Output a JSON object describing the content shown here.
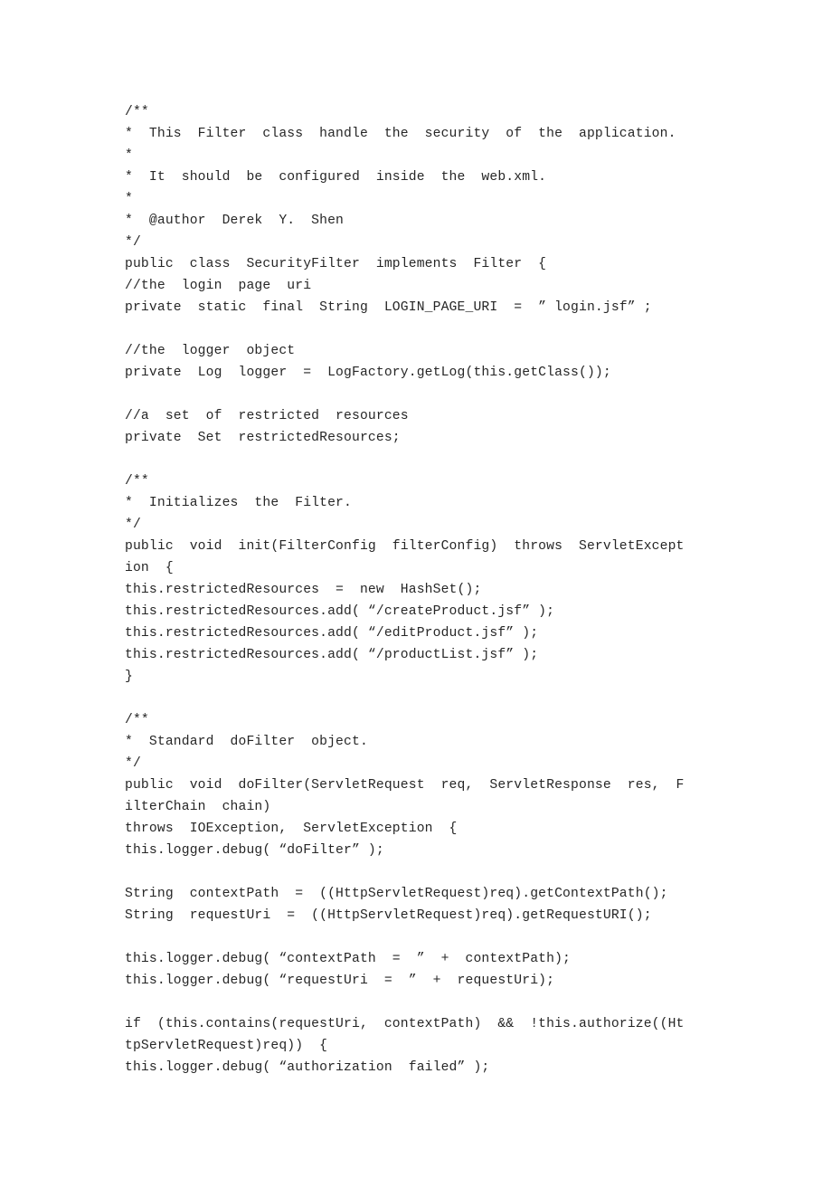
{
  "document": {
    "type": "source-code-listing",
    "language": "java",
    "page_background": "#ffffff",
    "text_color": "#262626",
    "lines": [
      "/**",
      "*  This  Filter  class  handle  the  security  of  the  application.",
      "*",
      "*  It  should  be  configured  inside  the  web.xml.",
      "*",
      "*  @author  Derek  Y.  Shen",
      "*/",
      "public  class  SecurityFilter  implements  Filter  {",
      "//the  login  page  uri",
      "private  static  final  String  LOGIN_PAGE_URI  =  ” login.jsf” ;",
      "",
      "//the  logger  object",
      "private  Log  logger  =  LogFactory.getLog(this.getClass());",
      "",
      "//a  set  of  restricted  resources",
      "private  Set  restrictedResources;",
      "",
      "/**",
      "*  Initializes  the  Filter.",
      "*/",
      "public  void  init(FilterConfig  filterConfig)  throws  ServletExcept",
      "ion  {",
      "this.restrictedResources  =  new  HashSet();",
      "this.restrictedResources.add( “/createProduct.jsf” );",
      "this.restrictedResources.add( “/editProduct.jsf” );",
      "this.restrictedResources.add( “/productList.jsf” );",
      "}",
      "",
      "/**",
      "*  Standard  doFilter  object.",
      "*/",
      "public  void  doFilter(ServletRequest  req,  ServletResponse  res,  F",
      "ilterChain  chain)",
      "throws  IOException,  ServletException  {",
      "this.logger.debug( “doFilter” );",
      "",
      "String  contextPath  =  ((HttpServletRequest)req).getContextPath();",
      "String  requestUri  =  ((HttpServletRequest)req).getRequestURI();",
      "",
      "this.logger.debug( “contextPath  =  ”  +  contextPath);",
      "this.logger.debug( “requestUri  =  ”  +  requestUri);",
      "",
      "if  (this.contains(requestUri,  contextPath)  &&  !this.authorize((Ht",
      "tpServletRequest)req))  {",
      "this.logger.debug( “authorization  failed” );"
    ]
  }
}
